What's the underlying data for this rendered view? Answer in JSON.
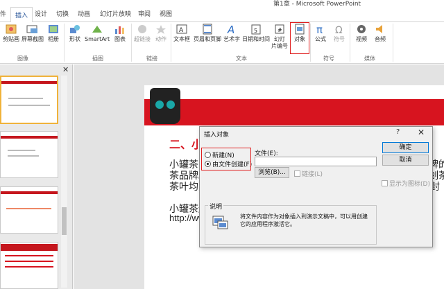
{
  "window": {
    "title": "第1章 - Microsoft PowerPoint"
  },
  "tabs": [
    {
      "label": "件"
    },
    {
      "label": "插入",
      "active": true
    },
    {
      "label": "设计"
    },
    {
      "label": "切换"
    },
    {
      "label": "动画"
    },
    {
      "label": "幻灯片放映"
    },
    {
      "label": "审阅"
    },
    {
      "label": "视图"
    }
  ],
  "ribbon": {
    "buttons": {
      "clip": "剪贴画",
      "screenshot": "屏幕截图",
      "album": "相册",
      "shapes": "形状",
      "smartart": "SmartArt",
      "chart": "图表",
      "hyperlink": "超链接",
      "action": "动作",
      "textbox": "文本框",
      "header_footer": "页眉和页脚",
      "wordart": "艺术字",
      "datetime": "日期和时间",
      "slide_number_1": "幻灯",
      "slide_number_2": "片编号",
      "object": "对象",
      "equation": "公式",
      "symbol": "符号",
      "video": "视频",
      "audio": "音频"
    },
    "groups": {
      "images": "图像",
      "illustrations": "插图",
      "links": "链接",
      "text": "文本",
      "symbols": "符号",
      "media": "媒体"
    }
  },
  "slide": {
    "heading": "二、小",
    "p1_line1": "小罐茶",
    "p1_line1_right": "牌的",
    "p1_line2": "茶品牌。",
    "p1_line2_right": "制茶",
    "p1_line3": "茶叶均为",
    "p1_line3_right": "封",
    "p2_line1": "小罐茶还",
    "p2_line2": "http://ww"
  },
  "dialog": {
    "title": "插入对象",
    "help": "?",
    "close": "✕",
    "radio_new": "新建(N)",
    "radio_from_file": "由文件创建(F)",
    "file_label": "文件(E):",
    "file_value": "",
    "browse": "浏览(B)...",
    "link": "链接(L)",
    "ok": "确定",
    "cancel": "取消",
    "display_as_icon": "显示为图标(D)",
    "explain_label": "说明",
    "explain_text_1": "将文件内容作为对象插入到演示文稿中，可以用创建",
    "explain_text_2": "它的应用程序激活它。"
  },
  "colors": {
    "accent_red": "#d7141f",
    "highlight_box": "#e02020",
    "word_blue": "#2b579a"
  }
}
